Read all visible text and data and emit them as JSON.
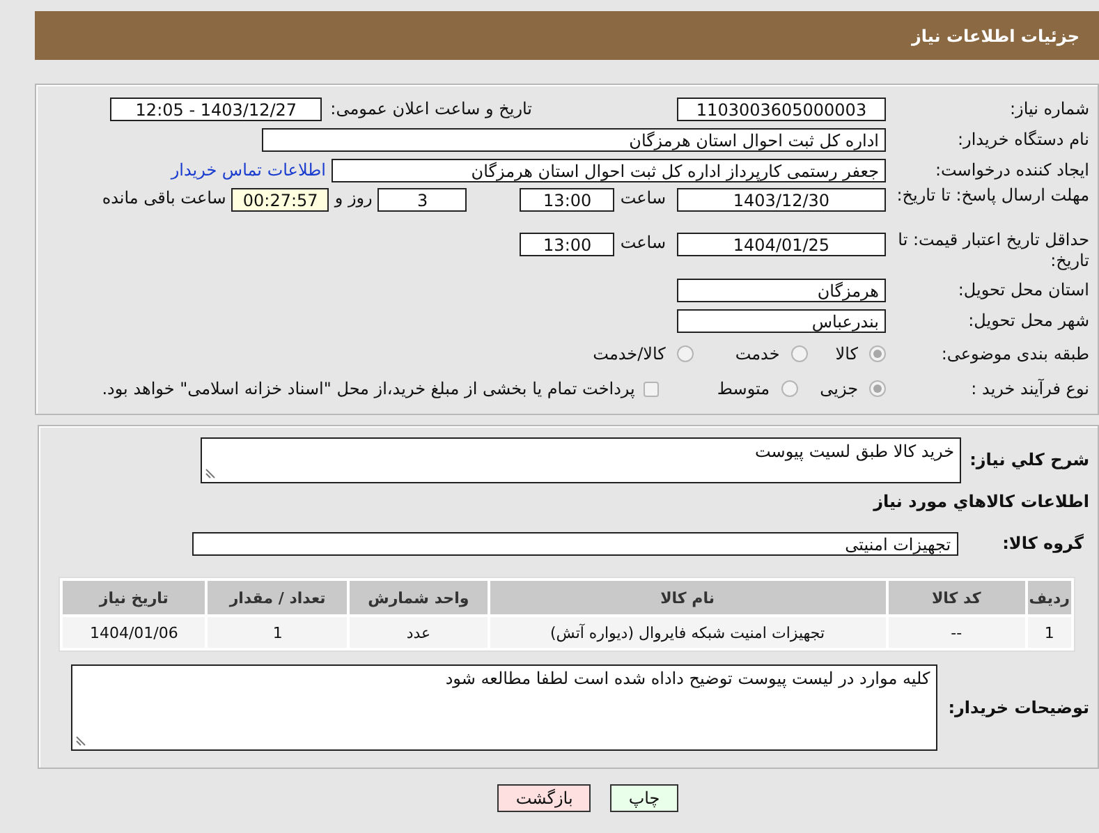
{
  "header": {
    "title": "جزئیات اطلاعات نیاز"
  },
  "need_number": {
    "label": "شماره نیاز:",
    "value": "1103003605000003"
  },
  "announce": {
    "label": "تاریخ و ساعت اعلان عمومی:",
    "value": "1403/12/27 - 12:05"
  },
  "buyer_org": {
    "label": "نام دستگاه خریدار:",
    "value": "اداره کل ثبت احوال استان هرمزگان"
  },
  "creator": {
    "label": "ایجاد کننده درخواست:",
    "value": "جعفر رستمی کارپرداز اداره کل ثبت احوال استان هرمزگان",
    "link": "اطلاعات تماس خریدار"
  },
  "response_deadline": {
    "label": "مهلت ارسال پاسخ: تا تاریخ:",
    "date": "1403/12/30",
    "time_label": "ساعت",
    "time": "13:00",
    "days": "3",
    "days_label": "روز و",
    "remaining": "00:27:57",
    "remaining_label": "ساعت باقی مانده"
  },
  "price_validity": {
    "label": "حداقل تاریخ اعتبار قیمت: تا تاریخ:",
    "date": "1404/01/25",
    "time_label": "ساعت",
    "time": "13:00"
  },
  "province": {
    "label": "استان محل تحویل:",
    "value": "هرمزگان"
  },
  "city": {
    "label": "شهر محل تحویل:",
    "value": "بندرعباس"
  },
  "category": {
    "label": "طبقه بندی موضوعی:",
    "options": [
      {
        "label": "کالا",
        "selected": true
      },
      {
        "label": "خدمت",
        "selected": false
      },
      {
        "label": "کالا/خدمت",
        "selected": false
      }
    ]
  },
  "process": {
    "label": "نوع فرآیند خرید :",
    "options": [
      {
        "label": "جزیی",
        "selected": true
      },
      {
        "label": "متوسط",
        "selected": false
      }
    ],
    "payment": {
      "checked": false,
      "text": "پرداخت تمام یا بخشی از مبلغ خرید،از محل \"اسناد خزانه اسلامی\" خواهد بود."
    }
  },
  "description": {
    "label": "شرح كلي نياز:",
    "value": "خرید کالا طبق لسیت پیوست"
  },
  "goods_title": "اطلاعات كالاهاي مورد نياز",
  "goods_group": {
    "label": "گروه کالا:",
    "value": "تجهیزات امنیتی"
  },
  "table": {
    "columns": [
      "ردیف",
      "کد کالا",
      "نام کالا",
      "واحد شمارش",
      "تعداد / مقدار",
      "تاریخ نیاز"
    ],
    "rows": [
      [
        "1",
        "--",
        "تجهیزات امنیت شبکه فایروال (دیواره آتش)",
        "عدد",
        "1",
        "1404/01/06"
      ]
    ]
  },
  "buyer_notes": {
    "label": "توضیحات خریدار:",
    "value": "کلیه موارد در لیست پیوست توضیح داداه شده است لطفا مطالعه شود"
  },
  "buttons": [
    {
      "label": "چاپ",
      "kind": "print"
    },
    {
      "label": "بازگشت",
      "kind": "back"
    }
  ]
}
